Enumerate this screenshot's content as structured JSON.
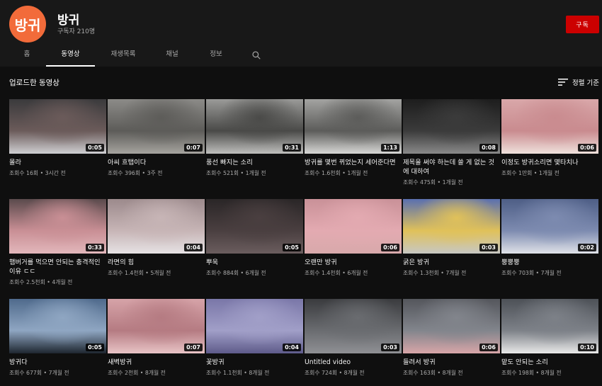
{
  "channel": {
    "avatar_text": "방귀",
    "avatar_color": "#f26b3a",
    "name": "방귀",
    "subscribers": "구독자 210명",
    "subscribe_label": "구독",
    "subscribe_color": "#cc0000"
  },
  "tabs": [
    {
      "label": "홈",
      "active": false
    },
    {
      "label": "동영상",
      "active": true
    },
    {
      "label": "재생목록",
      "active": false
    },
    {
      "label": "채널",
      "active": false
    },
    {
      "label": "정보",
      "active": false
    }
  ],
  "search_icon": "search-icon",
  "section": {
    "title": "업로드한 동영상",
    "sort_label": "정렬 기준",
    "sort_icon": "sort-icon"
  },
  "videos": [
    {
      "title": "몰라",
      "duration": "0:05",
      "views": "조회수 16회",
      "age": "3시간 전",
      "colors": [
        "#3a3a3c",
        "#6b5b5a",
        "#cfcfd2"
      ]
    },
    {
      "title": "아씨 흐탭이다",
      "duration": "0:07",
      "views": "조회수 396회",
      "age": "3주 전",
      "colors": [
        "#8c8b88",
        "#5d5c59",
        "#a6a49f"
      ]
    },
    {
      "title": "풍선 빠지는 소리",
      "duration": "0:31",
      "views": "조회수 521회",
      "age": "1개월 전",
      "colors": [
        "#9a9a98",
        "#4a4a48",
        "#bfbfbd"
      ]
    },
    {
      "title": "방귀를 몇번 뀌었는지 세어준다면",
      "duration": "1:13",
      "views": "조회수 1.6천회",
      "age": "1개월 전",
      "colors": [
        "#a3a3a1",
        "#5c5c5a",
        "#d8d8d6"
      ]
    },
    {
      "title": "제목을 써야 하는데 쓸 게 없는 것에 대하여",
      "duration": "0:08",
      "views": "조회수 475회",
      "age": "1개월 전",
      "colors": [
        "#1d1d1d",
        "#3b3b3b",
        "#8a8a8a"
      ]
    },
    {
      "title": "이정도 방귀소리면 몇타치나",
      "duration": "0:06",
      "views": "조회수 1만회",
      "age": "1개월 전",
      "colors": [
        "#d9a7a9",
        "#c98b8f",
        "#efe1dc"
      ]
    },
    {
      "title": "햄버거를 먹으면 안되는 충격적인 이유 ㄷㄷ",
      "duration": "0:33",
      "views": "조회수 2.5천회",
      "age": "4개월 전",
      "colors": [
        "#5a4a4c",
        "#c98f95",
        "#e2b7bb"
      ]
    },
    {
      "title": "라면의 힘",
      "duration": "0:04",
      "views": "조회수 1.4천회",
      "age": "5개월 전",
      "colors": [
        "#9c8a8c",
        "#c7b5b6",
        "#e6e2e4"
      ]
    },
    {
      "title": "뿌욱",
      "duration": "0:05",
      "views": "조회수 884회",
      "age": "6개월 전",
      "colors": [
        "#2a2627",
        "#4a3f40",
        "#6a5d5e"
      ]
    },
    {
      "title": "오랜만 방귀",
      "duration": "0:06",
      "views": "조회수 1.4천회",
      "age": "6개월 전",
      "colors": [
        "#c99198",
        "#e3aab1",
        "#d8a9ab"
      ]
    },
    {
      "title": "굵은 방귀",
      "duration": "0:03",
      "views": "조회수 1.3천회",
      "age": "7개월 전",
      "colors": [
        "#5a6fb0",
        "#e0c15a",
        "#c7c7c3"
      ]
    },
    {
      "title": "뿡뿡뿡",
      "duration": "0:02",
      "views": "조회수 703회",
      "age": "7개월 전",
      "colors": [
        "#4e5e86",
        "#7d8bb0",
        "#e0e2e8"
      ]
    },
    {
      "title": "방귀다",
      "duration": "0:05",
      "views": "조회수 677회",
      "age": "7개월 전",
      "colors": [
        "#4f6a8c",
        "#8fa6c2",
        "#1e2630"
      ]
    },
    {
      "title": "새벽방귀",
      "duration": "0:07",
      "views": "조회수 2천회",
      "age": "8개월 전",
      "colors": [
        "#d6a3a8",
        "#b57b82",
        "#e8c4c6"
      ]
    },
    {
      "title": "꽃방귀",
      "duration": "0:04",
      "views": "조회수 1.1천회",
      "age": "8개월 전",
      "colors": [
        "#7a77a8",
        "#a19fc8",
        "#5e5b8a"
      ]
    },
    {
      "title": "Untitled video",
      "duration": "0:03",
      "views": "조회수 724회",
      "age": "8개월 전",
      "colors": [
        "#3a3b3e",
        "#6a6c70",
        "#8f9094"
      ]
    },
    {
      "title": "들려서 방귀",
      "duration": "0:06",
      "views": "조회수 163회",
      "age": "8개월 전",
      "colors": [
        "#54565c",
        "#82858c",
        "#d8a5a8"
      ]
    },
    {
      "title": "맡도 안되는 소리",
      "duration": "0:10",
      "views": "조회수 198회",
      "age": "8개월 전",
      "colors": [
        "#4d5157",
        "#7d8188",
        "#e9e9e9"
      ]
    }
  ]
}
